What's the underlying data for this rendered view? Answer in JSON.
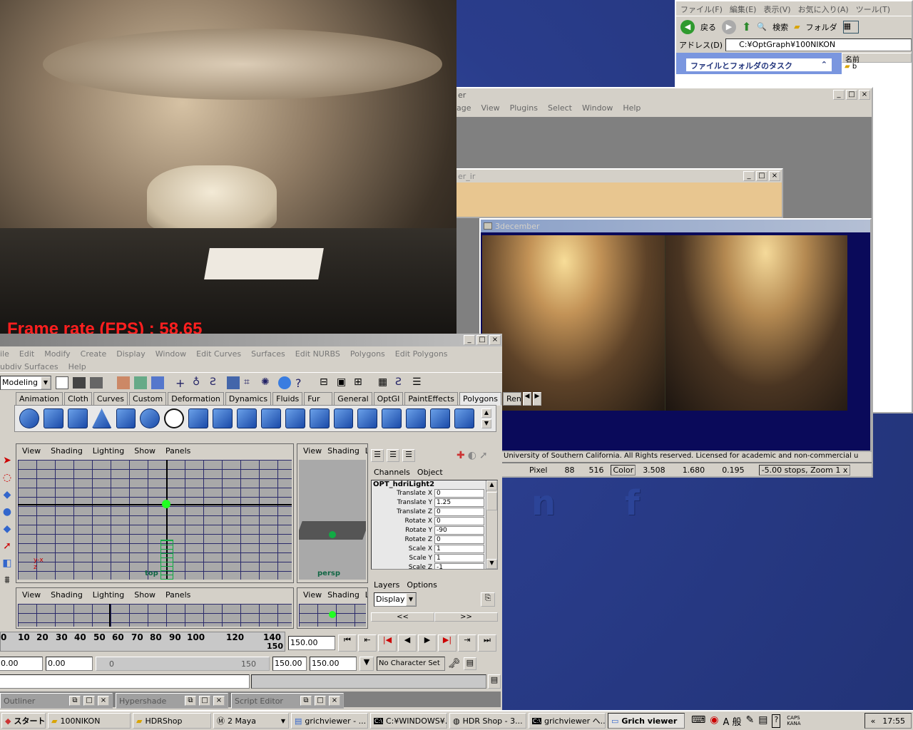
{
  "render_window": {
    "fps_label": "Frame rate (FPS) : 58.65"
  },
  "explorer": {
    "menu": [
      "ファイル(F)",
      "編集(E)",
      "表示(V)",
      "お気に入り(A)",
      "ツール(T)"
    ],
    "back_label": "戻る",
    "search_label": "検索",
    "folder_label": "フォルダ",
    "address_label": "アドレス(D)",
    "address_value": "C:¥OptGraph¥100NIKON",
    "task_panel_title": "ファイルとフォルダのタスク",
    "col_name": "名前",
    "file_item": "b"
  },
  "hdr_shop": {
    "title_partial": "er",
    "menu": [
      "age",
      "View",
      "Plugins",
      "Select",
      "Window",
      "Help"
    ],
    "sub_title_partial": "er_ir",
    "image_title": "3december",
    "copyright": "University of Southern California.  All Rights reserved.  Licensed for academic and non-commercial u",
    "status": {
      "pixel_label": "Pixel",
      "px_x": "88",
      "px_y": "516",
      "color_label": "Color",
      "r": "3.508",
      "g": "1.680",
      "b": "0.195",
      "stops": "-5.00 stops, Zoom 1 x"
    }
  },
  "maya": {
    "menu1": [
      "ile",
      "Edit",
      "Modify",
      "Create",
      "Display",
      "Window",
      "Edit Curves",
      "Surfaces",
      "Edit NURBS",
      "Polygons",
      "Edit Polygons"
    ],
    "menu2": [
      "ubdiv Surfaces",
      "Help"
    ],
    "mode": "Modeling",
    "shelf_tabs": [
      "Animation",
      "Cloth",
      "Curves",
      "Custom",
      "Deformation",
      "Dynamics",
      "Fluids",
      "Fur",
      "General",
      "OptGI",
      "PaintEffects",
      "Polygons",
      "Ren"
    ],
    "active_tab": "Polygons",
    "viewport_menu": [
      "View",
      "Shading",
      "Lighting",
      "Show",
      "Panels"
    ],
    "viewport_menu_short": [
      "View",
      "Shading",
      "L"
    ],
    "top_label": "top",
    "persp_label": "persp",
    "channels_header": [
      "Channels",
      "Object"
    ],
    "object_name": "OPT_hdriLight2",
    "channels": [
      {
        "name": "Translate X",
        "value": "0"
      },
      {
        "name": "Translate Y",
        "value": "1.25"
      },
      {
        "name": "Translate Z",
        "value": "0"
      },
      {
        "name": "Rotate X",
        "value": "0"
      },
      {
        "name": "Rotate Y",
        "value": "-90"
      },
      {
        "name": "Rotate Z",
        "value": "0"
      },
      {
        "name": "Scale X",
        "value": "1"
      },
      {
        "name": "Scale Y",
        "value": "1"
      },
      {
        "name": "Scale Z",
        "value": "-1"
      }
    ],
    "layers_header": [
      "Layers",
      "Options"
    ],
    "layer_mode": "Display",
    "layer_nav": [
      "<<",
      ">>"
    ],
    "timeline_ticks": [
      "0",
      "10",
      "20",
      "30",
      "40",
      "50",
      "60",
      "70",
      "80",
      "90",
      "100",
      "120",
      "140"
    ],
    "timeline_end": "150",
    "current_frame": "150.00",
    "range_start": "0.00",
    "range_start2": "0.00",
    "range_slider_start": "0",
    "range_slider_end": "150",
    "range_end": "150.00",
    "range_end2": "150.00",
    "character_set": "No Character Set",
    "minimized": [
      "Outliner",
      "Hypershade",
      "Script Editor"
    ]
  },
  "taskbar": {
    "start": "スタート",
    "items": [
      "100NIKON",
      "HDRShop",
      "2 Maya",
      "grichviewer - ...",
      "C:¥WINDOWS¥...",
      "HDR Shop - 3...",
      "grichviewer へ...",
      "Grich viewer"
    ],
    "active": "Grich viewer",
    "ime": "A 般",
    "caps": "CAPS",
    "kana": "KANA",
    "clock": "17:55"
  }
}
